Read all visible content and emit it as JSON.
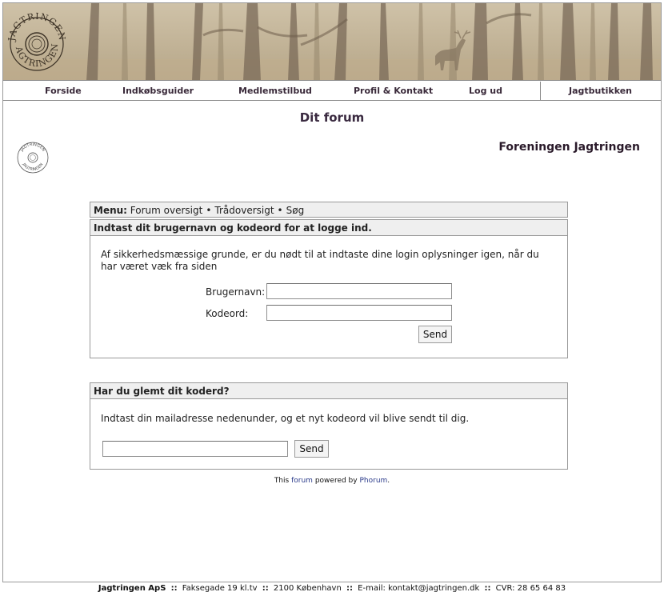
{
  "banner": {
    "logo_text_top": "JAGTRINGEN",
    "logo_text_bottom": "JAGTRINGEN"
  },
  "nav": {
    "items": [
      "Forside",
      "Indkøbsguider",
      "Medlemstilbud",
      "Profil & Kontakt",
      "Log ud",
      "Jagtbutikken"
    ]
  },
  "page": {
    "title": "Dit forum",
    "org_name": "Foreningen Jagtringen"
  },
  "menu": {
    "label": "Menu:",
    "links": [
      "Forum oversigt",
      "Trådoversigt",
      "Søg"
    ]
  },
  "login": {
    "header": "Indtast dit brugernavn og kodeord for at logge ind.",
    "description": "Af sikkerhedsmæssige grunde, er du nødt til at indtaste dine login oplysninger igen, når du har været væk fra siden",
    "username_label": "Brugernavn:",
    "username_value": "",
    "password_label": "Kodeord:",
    "password_value": "",
    "submit": "Send"
  },
  "forgot": {
    "header": "Har du glemt dit koderd?",
    "description": "Indtast din mailadresse nedenunder, og et nyt kodeord vil blive sendt til dig.",
    "email_value": "",
    "submit": "Send"
  },
  "powered": {
    "prefix": "This",
    "forum_link": "forum",
    "middle": "powered by",
    "phorum_link": "Phorum",
    "suffix": "."
  },
  "footer": {
    "company": "Jagtringen ApS",
    "address": "Faksegade 19 kl.tv",
    "city": "2100 København",
    "email": "E-mail: kontakt@jagtringen.dk",
    "cvr": "CVR: 28 65 64 83",
    "separator": "::"
  }
}
